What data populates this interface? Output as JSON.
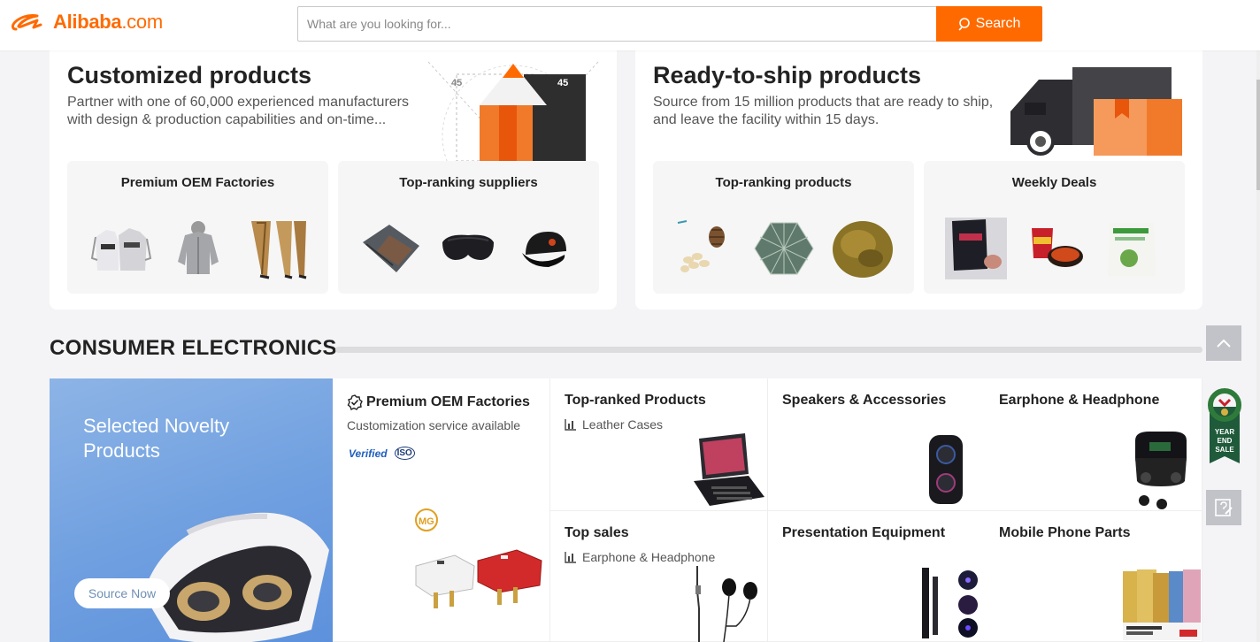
{
  "header": {
    "logo_brand": "Alibaba",
    "logo_domain": ".com",
    "search_placeholder": "What are you looking for...",
    "search_button": "Search"
  },
  "customized": {
    "title": "Customized products",
    "description_line1": "Partner with one of 60,000 experienced manufacturers",
    "description_line2": "with design & production capabilities and on-time...",
    "illustration_labels": [
      "45",
      "45"
    ],
    "subcards": [
      {
        "title": "Premium OEM Factories",
        "thumbs": [
          "hoodies-image",
          "grey-jacket-image",
          "leggings-image"
        ]
      },
      {
        "title": "Top-ranking suppliers",
        "thumbs": [
          "bag-image",
          "eye-mask-image",
          "cap-image"
        ]
      }
    ]
  },
  "ready_to_ship": {
    "title": "Ready-to-ship products",
    "description_line1": "Source from 15 million products that are ready to ship,",
    "description_line2": "and leave the facility within 15 days.",
    "subcards": [
      {
        "title": "Top-ranking products",
        "thumbs": [
          "pine-nuts-image",
          "fishing-net-image",
          "herb-powder-image"
        ]
      },
      {
        "title": "Weekly Deals",
        "thumbs": [
          "snack-pack-image",
          "noodle-bowl-image",
          "matcha-pouch-image"
        ]
      }
    ]
  },
  "section": {
    "title": "CONSUMER ELECTRONICS"
  },
  "banner": {
    "title": "Selected Novelty Products",
    "button": "Source Now"
  },
  "grid": {
    "oem": {
      "title": "Premium OEM Factories",
      "subtitle": "Customization service available",
      "badge_verified": "Verified",
      "badge_iso": "ISO"
    },
    "cells": [
      {
        "title": "Top-ranked Products",
        "subtitle": "Leather Cases"
      },
      {
        "title": "Speakers & Accessories",
        "subtitle": ""
      },
      {
        "title": "Earphone & Headphone",
        "subtitle": ""
      },
      {
        "title": "Top sales",
        "subtitle": "Earphone & Headphone"
      },
      {
        "title": "Presentation Equipment",
        "subtitle": ""
      },
      {
        "title": "Mobile Phone Parts",
        "subtitle": ""
      }
    ]
  },
  "side": {
    "sale_badge": "YEAR END SALE"
  },
  "colors": {
    "brand": "#ff6a00",
    "banner_blue": "#6f9fe0",
    "sale_green": "#1f5a3a"
  }
}
